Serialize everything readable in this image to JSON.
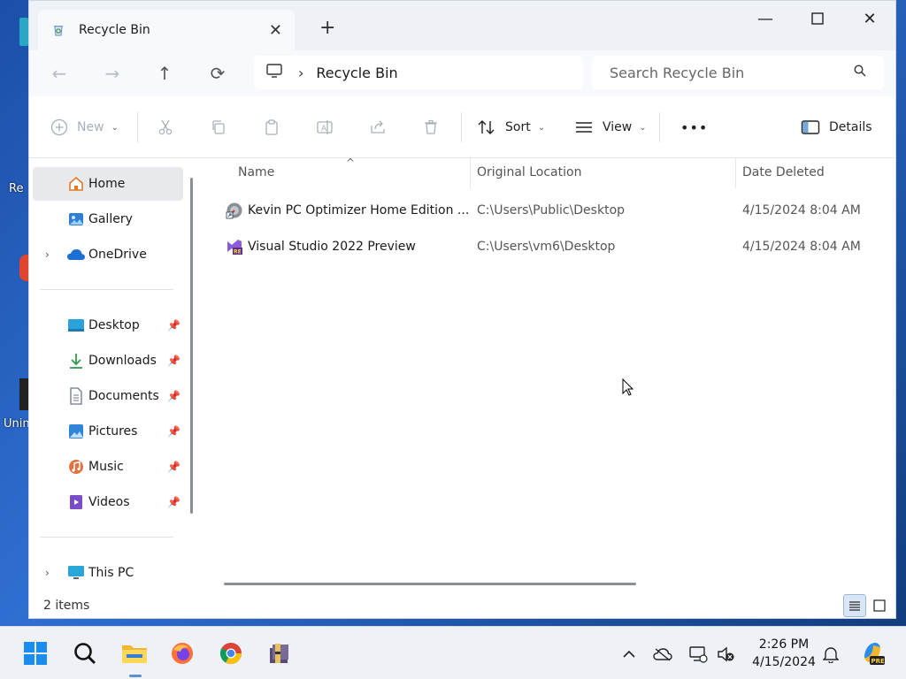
{
  "desktop": {
    "labels": [
      "Re",
      "Unin"
    ]
  },
  "window": {
    "tab": {
      "title": "Recycle Bin"
    },
    "address": {
      "crumb": "Recycle Bin"
    },
    "search": {
      "placeholder": "Search Recycle Bin"
    },
    "toolbar": {
      "new_label": "New",
      "sort_label": "Sort",
      "view_label": "View",
      "more_label": "•••",
      "details_label": "Details"
    },
    "sidebar": {
      "items": [
        {
          "label": "Home"
        },
        {
          "label": "Gallery"
        },
        {
          "label": "OneDrive"
        },
        {
          "label": "Desktop"
        },
        {
          "label": "Downloads"
        },
        {
          "label": "Documents"
        },
        {
          "label": "Pictures"
        },
        {
          "label": "Music"
        },
        {
          "label": "Videos"
        },
        {
          "label": "This PC"
        }
      ]
    },
    "columns": {
      "name": "Name",
      "original_location": "Original Location",
      "date_deleted": "Date Deleted"
    },
    "rows": [
      {
        "name": "Kevin PC Optimizer Home Edition ...",
        "location": "C:\\Users\\Public\\Desktop",
        "date": "4/15/2024 8:04 AM"
      },
      {
        "name": "Visual Studio 2022 Preview",
        "location": "C:\\Users\\vm6\\Desktop",
        "date": "4/15/2024 8:04 AM"
      }
    ],
    "status": {
      "count": "2 items"
    }
  },
  "taskbar": {
    "time": "2:26 PM",
    "date": "4/15/2024"
  },
  "colors": {
    "accent": "#0067c0",
    "selected_bg": "#e7e9ec",
    "titlebar_bg": "#eef1f6"
  }
}
